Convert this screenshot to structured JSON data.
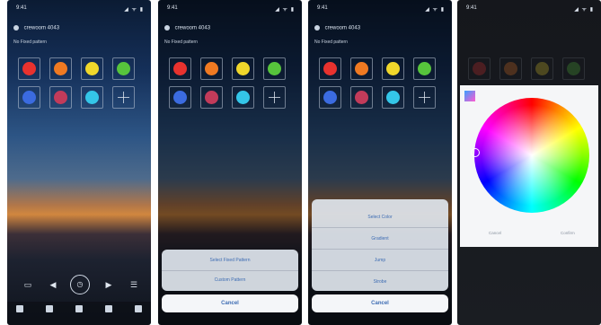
{
  "status": {
    "time": "9:41",
    "icons": "◢ ᯤ ▮"
  },
  "device": {
    "name": "crewoom 4043",
    "subtitle": "No Fixed pattern"
  },
  "tiles": [
    {
      "color": "#e8322e",
      "type": "blob"
    },
    {
      "color": "#f07a22",
      "type": "blob"
    },
    {
      "color": "#f0d72b",
      "type": "blob"
    },
    {
      "color": "#57c43c",
      "type": "blob"
    },
    {
      "color": "#3b6be0",
      "type": "blob"
    },
    {
      "color": "#c23b5a",
      "type": "blob"
    },
    {
      "color": "#34c6e8",
      "type": "blob"
    },
    {
      "color": "",
      "type": "plus"
    }
  ],
  "controls": {
    "c1": "▭",
    "c2": "◀",
    "c3": "◷",
    "c4": "▶",
    "c5": "☰"
  },
  "tabs": [
    "",
    "",
    "",
    "",
    ""
  ],
  "sheet2": {
    "items": [
      "Select Fixed Pattern",
      "Custom Pattern"
    ],
    "cancel": "Cancel"
  },
  "sheet3": {
    "items": [
      "Select Color",
      "Gradient",
      "Jump",
      "Strobe"
    ],
    "cancel": "Cancel"
  },
  "picker": {
    "left_label": "Cancel",
    "right_label": "Confirm"
  }
}
